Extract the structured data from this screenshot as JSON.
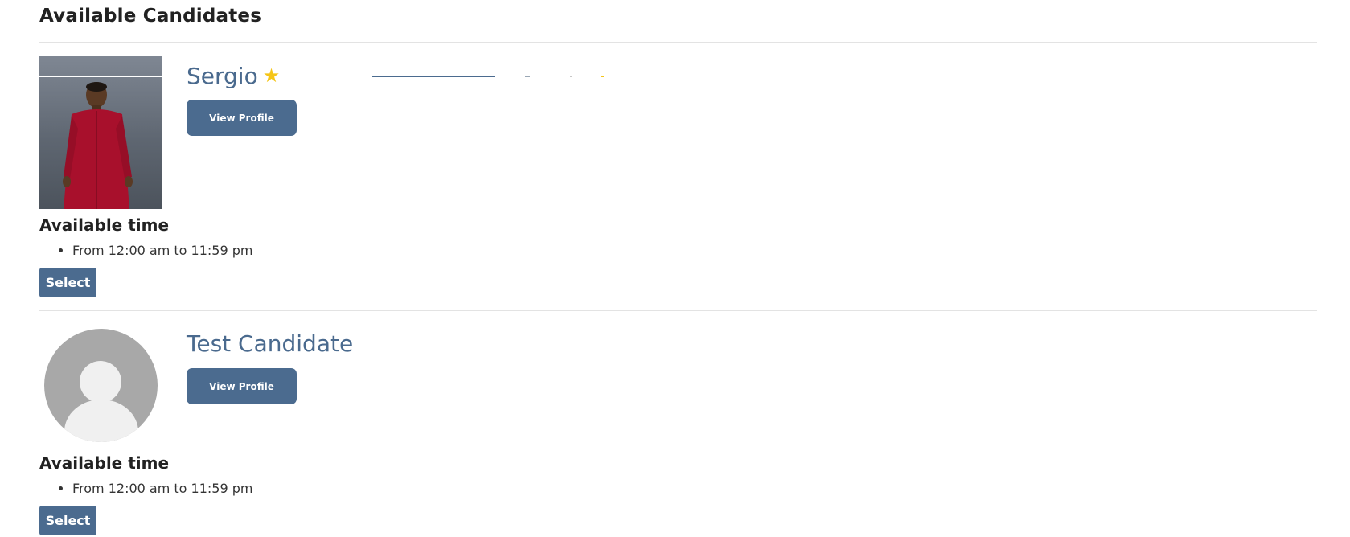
{
  "page": {
    "heading": "Available Candidates"
  },
  "candidates": [
    {
      "name": "Sergio",
      "featured_icon": "star-icon",
      "view_profile_label": "View Profile",
      "photo_icon": "candidate-photo",
      "available_title": "Available time",
      "slots": [
        "From 12:00 am to 11:59 pm"
      ],
      "select_label": "Select"
    },
    {
      "name": "Test Candidate",
      "view_profile_label": "View Profile",
      "photo_icon": "default-avatar-icon",
      "available_title": "Available time",
      "slots": [
        "From 12:00 am to 11:59 pm"
      ],
      "select_label": "Select"
    }
  ],
  "colors": {
    "accent": "#4b6b8f",
    "name_text": "#4a6a8e",
    "star": "#f5c518",
    "avatar_bg": "#a8a8a8",
    "divider": "#e3e3e3"
  }
}
